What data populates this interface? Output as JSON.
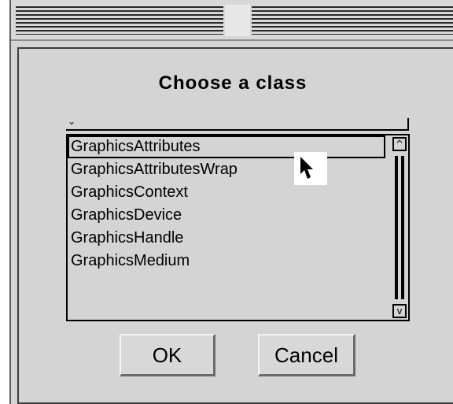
{
  "dialog": {
    "title": "Choose a class",
    "filter_value": "",
    "filter_icon": "chevron-down-icon",
    "classes": [
      "GraphicsAttributes",
      "GraphicsAttributesWrap",
      "GraphicsContext",
      "GraphicsDevice",
      "GraphicsHandle",
      "GraphicsMedium"
    ],
    "selected_index": 0,
    "scroll": {
      "up_icon": "chevron-up-icon",
      "down_icon": "chevron-down-icon"
    },
    "buttons": {
      "ok_label": "OK",
      "cancel_label": "Cancel"
    }
  },
  "colors": {
    "background": "#d4d4d4",
    "text": "#000000",
    "border": "#000000"
  }
}
